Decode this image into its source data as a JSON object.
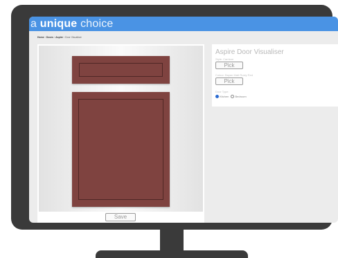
{
  "brand": {
    "word1": "a",
    "word2": "unique",
    "word3": "choice"
  },
  "breadcrumb": {
    "home": "Home",
    "sep1": " › ",
    "doors": "Doors",
    "sep2": " › ",
    "aspire": "Aspire",
    "sep3": " › ",
    "current": "Door Visualiser"
  },
  "preview": {
    "save_label": "Save"
  },
  "panel": {
    "title": "Aspire Door Visualiser",
    "style_label": "Style: Carrison",
    "style_pick": "Pick",
    "colour_label": "Colour: Bayan Matt Rusty Red",
    "colour_pick": "Pick",
    "door_type_label": "Door Type:",
    "option_kitchen": "Kitchen",
    "option_bedroom": "Bedroom"
  },
  "colors": {
    "header": "#4a93e4",
    "door": "#7f4340",
    "frame": "#3a3a3a"
  }
}
